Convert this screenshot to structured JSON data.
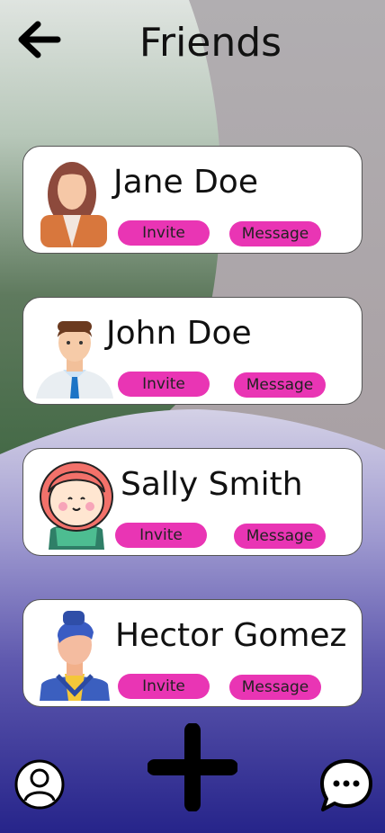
{
  "header": {
    "title": "Friends"
  },
  "friends": [
    {
      "name": "Jane Doe",
      "invite_label": "Invite",
      "message_label": "Message"
    },
    {
      "name": "John Doe",
      "invite_label": "Invite",
      "message_label": "Message"
    },
    {
      "name": "Sally Smith",
      "invite_label": "Invite",
      "message_label": "Message"
    },
    {
      "name": "Hector Gomez",
      "invite_label": "Invite",
      "message_label": "Message"
    }
  ],
  "colors": {
    "accent": "#e935b4",
    "card_bg": "#ffffff",
    "text": "#111111"
  },
  "icons": {
    "back": "arrow-left-icon",
    "profile": "user-icon",
    "add": "plus-icon",
    "chat": "chat-bubble-icon"
  }
}
